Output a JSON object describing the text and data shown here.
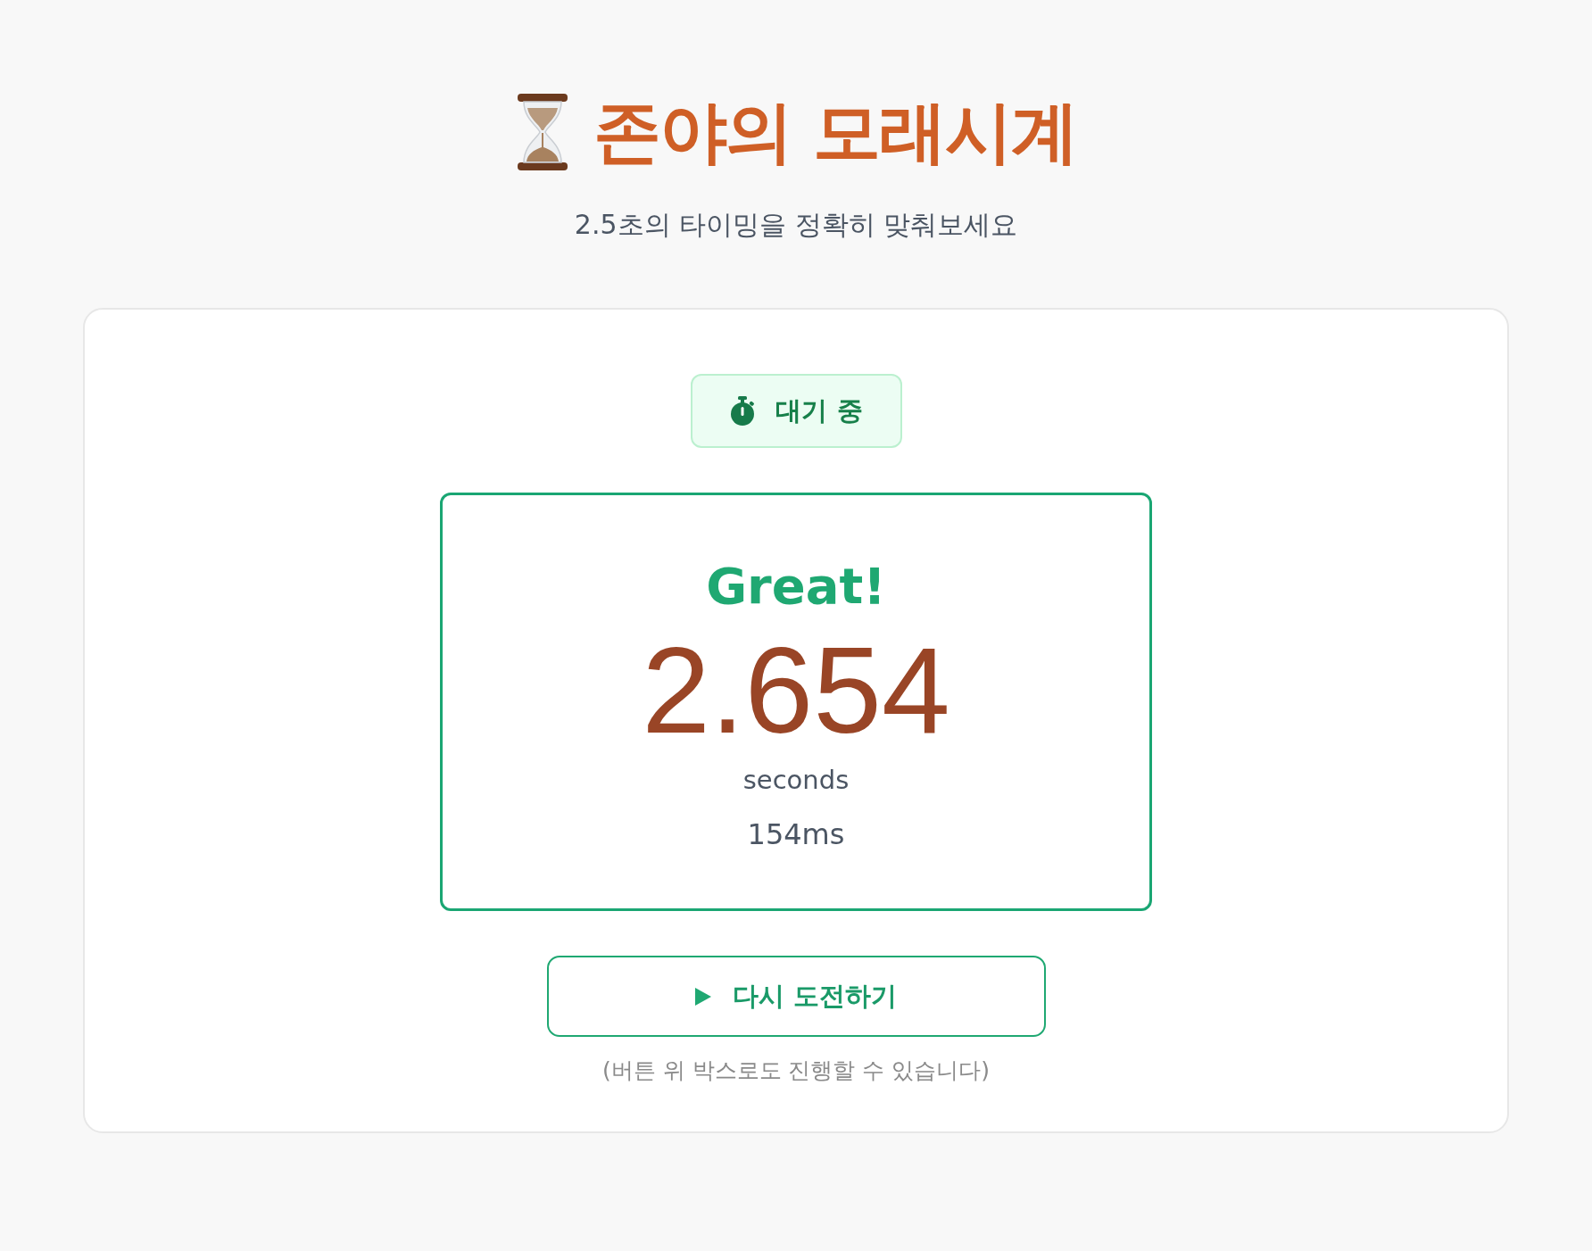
{
  "header": {
    "title": "존야의 모래시계",
    "subtitle": "2.5초의 타이밍을 정확히 맞춰보세요"
  },
  "status_badge": {
    "label": "대기 중"
  },
  "result": {
    "rating": "Great!",
    "time": "2.654",
    "unit": "seconds",
    "offset": "154ms"
  },
  "retry_button": {
    "label": "다시 도전하기"
  },
  "hint": "(버튼 위 박스로도 진행할 수 있습니다)"
}
